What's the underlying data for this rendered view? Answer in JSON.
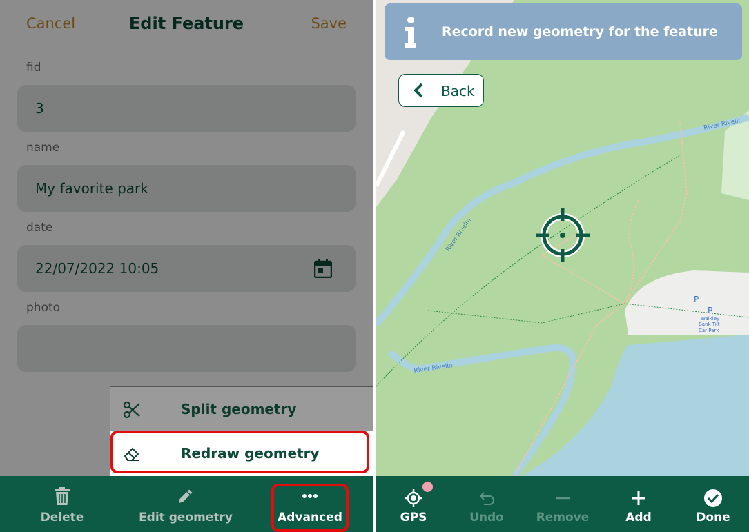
{
  "form": {
    "cancel_label": "Cancel",
    "title": "Edit Feature",
    "save_label": "Save",
    "fields": [
      {
        "label": "fid",
        "value": "3"
      },
      {
        "label": "name",
        "value": "My favorite park"
      },
      {
        "label": "date",
        "value": "22/07/2022 10:05"
      },
      {
        "label": "photo",
        "value": ""
      }
    ]
  },
  "menu": {
    "items": [
      {
        "label": "Split geometry",
        "icon": "scissors-icon"
      },
      {
        "label": "Redraw geometry",
        "icon": "eraser-icon"
      }
    ]
  },
  "form_toolbar": {
    "delete_label": "Delete",
    "edit_geometry_label": "Edit geometry",
    "advanced_label": "Advanced"
  },
  "map": {
    "banner_text": "Record new geometry for the feature",
    "back_label": "Back",
    "labels": {
      "river_1": "River Rivelin",
      "river_2": "River Rivelin",
      "river_3": "River Rivelin",
      "parking_1": "P",
      "parking_2": "P",
      "car_park_line1": "Walkley",
      "car_park_line2": "Bank Tilt",
      "car_park_line3": "Car Park"
    }
  },
  "map_toolbar": {
    "gps_label": "GPS",
    "undo_label": "Undo",
    "remove_label": "Remove",
    "add_label": "Add",
    "done_label": "Done"
  },
  "colors": {
    "primary": "#0d5b45",
    "accent": "#c98a2e",
    "highlight": "#e30b0b",
    "banner": "#8aa9c7"
  }
}
